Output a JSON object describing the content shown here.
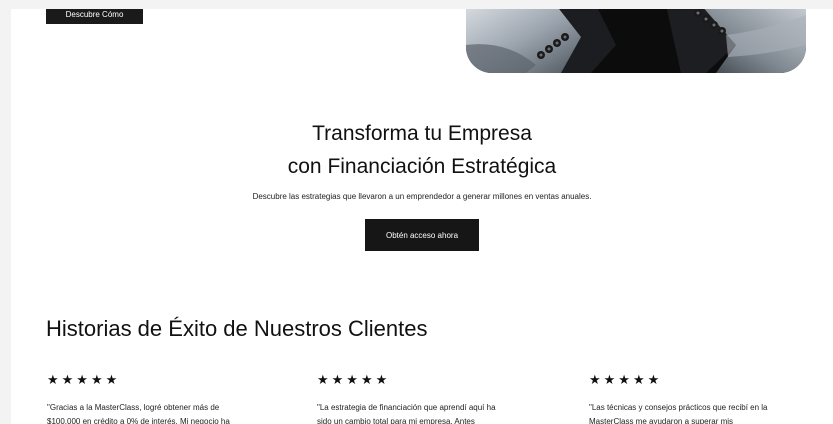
{
  "hero": {
    "button_label": "Descubre Cómo"
  },
  "cta": {
    "title_line1": "Transforma tu Empresa",
    "title_line2": "con Financiación Estratégica",
    "subtitle": "Descubre las estrategias que llevaron a un emprendedor a generar millones en ventas anuales.",
    "button_label": "Obtén acceso ahora"
  },
  "stories": {
    "title": "Historias de Éxito de Nuestros Clientes",
    "testimonials": [
      {
        "rating": 5,
        "stars": "★★★★★",
        "quote": "\"Gracias a la MasterClass, logré obtener más de\n$100,000 en crédito a 0% de interés. Mi negocio ha"
      },
      {
        "rating": 5,
        "stars": "★★★★★",
        "quote": "\"La estrategia de financiación que aprendí aquí ha\nsido un cambio total para mi empresa. Antes"
      },
      {
        "rating": 5,
        "stars": "★★★★★",
        "quote": "\"Las técnicas y consejos prácticos que recibí en la\nMasterClass me ayudaron a superar mis"
      }
    ]
  },
  "colors": {
    "page_bg": "#f3f3f3",
    "content_bg": "#ffffff",
    "button_bg": "#161616",
    "button_text": "#ffffff",
    "text": "#111111"
  }
}
